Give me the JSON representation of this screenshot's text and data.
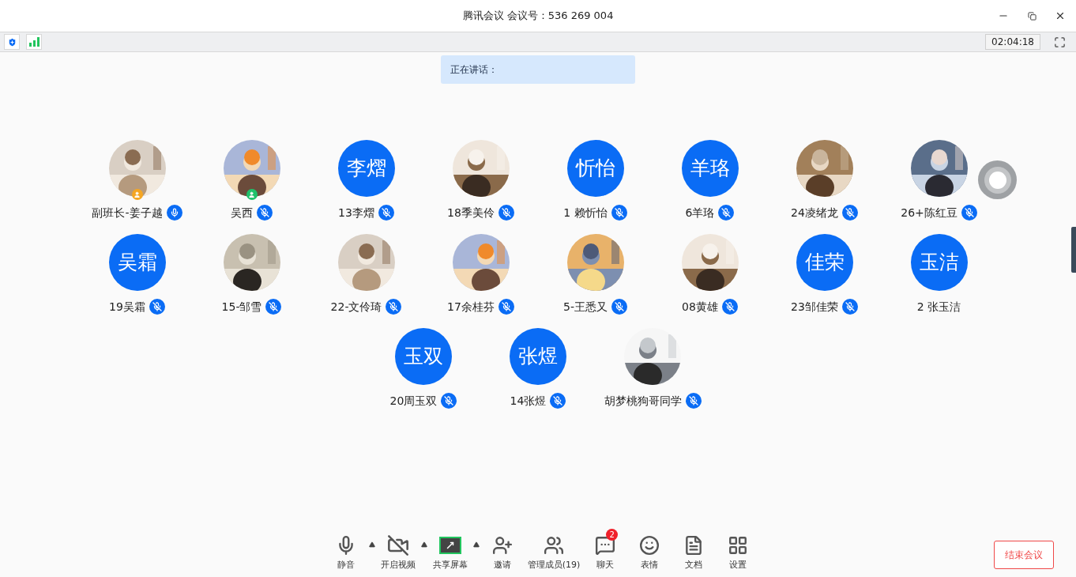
{
  "window": {
    "title": "腾讯会议 会议号：536 269 004"
  },
  "status_bar": {
    "timer": "02:04:18"
  },
  "speaking": {
    "label": "正在讲话："
  },
  "participant_rows": [
    [
      {
        "name": "副班长-姜子越",
        "kind": "picture",
        "mic_icon": true,
        "muted": false,
        "color": "#f5a623"
      },
      {
        "name": "吴西",
        "kind": "picture",
        "mic_icon": true,
        "muted": true,
        "color": "#1fc16b"
      },
      {
        "name": "13李熠",
        "kind": "initials",
        "initials": "李熠",
        "mic_icon": true,
        "muted": true
      },
      {
        "name": "18季美伶",
        "kind": "picture",
        "mic_icon": true,
        "muted": true
      },
      {
        "name": "1 赖忻怡",
        "kind": "initials",
        "initials": "忻怡",
        "mic_icon": true,
        "muted": true
      },
      {
        "name": "6羊珞",
        "kind": "initials",
        "initials": "羊珞",
        "mic_icon": true,
        "muted": true
      },
      {
        "name": "24凌绪龙",
        "kind": "picture",
        "mic_icon": true,
        "muted": true
      },
      {
        "name": "26+陈红豆",
        "kind": "picture",
        "mic_icon": true,
        "muted": true
      }
    ],
    [
      {
        "name": "19吴霜",
        "kind": "initials",
        "initials": "吴霜",
        "mic_icon": true,
        "muted": true
      },
      {
        "name": "15-邹雪",
        "kind": "picture",
        "mic_icon": true,
        "muted": true
      },
      {
        "name": "22-文伶琦",
        "kind": "picture",
        "mic_icon": true,
        "muted": true
      },
      {
        "name": "17余桂芬",
        "kind": "picture",
        "mic_icon": true,
        "muted": true
      },
      {
        "name": "5-王悉又",
        "kind": "picture",
        "mic_icon": true,
        "muted": true
      },
      {
        "name": "08黄雄",
        "kind": "picture",
        "mic_icon": true,
        "muted": true
      },
      {
        "name": "23邹佳荣",
        "kind": "initials",
        "initials": "佳荣",
        "mic_icon": true,
        "muted": true
      },
      {
        "name": "2 张玉洁",
        "kind": "initials",
        "initials": "玉洁",
        "mic_icon": false
      }
    ],
    [
      {
        "name": "20周玉双",
        "kind": "initials",
        "initials": "玉双",
        "mic_icon": true,
        "muted": true
      },
      {
        "name": "14张煜",
        "kind": "initials",
        "initials": "张煜",
        "mic_icon": true,
        "muted": true
      },
      {
        "name": "胡梦桃狗哥同学",
        "kind": "picture",
        "mic_icon": true,
        "muted": true
      }
    ]
  ],
  "toolbar": [
    {
      "kind": "mic",
      "label": "静音",
      "menu": true
    },
    {
      "kind": "video",
      "label": "开启视频",
      "menu": true
    },
    {
      "kind": "share",
      "label": "共享屏幕",
      "menu": true
    },
    {
      "kind": "invite",
      "label": "邀请",
      "menu": false
    },
    {
      "kind": "members",
      "label": "管理成员(19)",
      "menu": false
    },
    {
      "kind": "chat",
      "label": "聊天",
      "menu": false,
      "badge": "2"
    },
    {
      "kind": "emoji",
      "label": "表情",
      "menu": false
    },
    {
      "kind": "doc",
      "label": "文档",
      "menu": false
    },
    {
      "kind": "settings",
      "label": "设置",
      "menu": false
    }
  ],
  "end_button": {
    "label": "结束会议"
  }
}
